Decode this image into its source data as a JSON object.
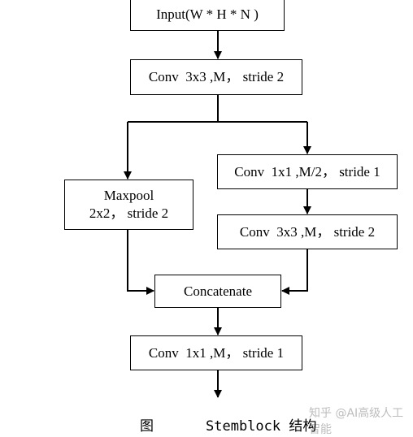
{
  "nodes": {
    "input": "Input(W * H * N )",
    "conv1": "Conv  3x3 ,M， stride 2",
    "conv2": "Conv  1x1 ,M/2， stride 1",
    "maxpool": "Maxpool\n2x2， stride 2",
    "conv3": "Conv  3x3 ,M， stride 2",
    "concat": "Concatenate",
    "conv4": "Conv  1x1 ,M， stride 1"
  },
  "caption": {
    "figure_label": "图",
    "title": "Stemblock 结构"
  },
  "watermark": "知乎 @AI高级人工智能"
}
